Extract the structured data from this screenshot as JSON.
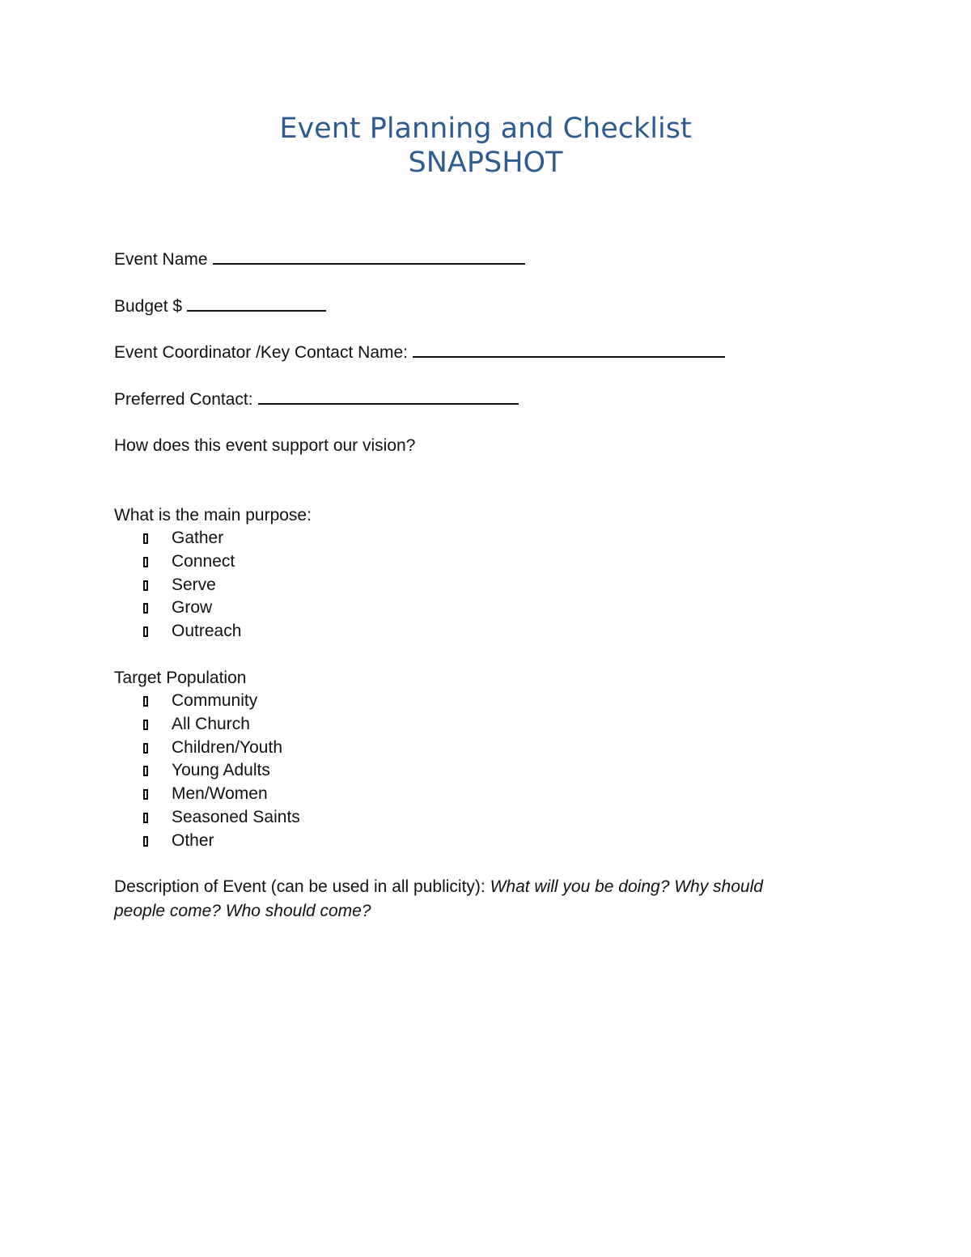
{
  "document": {
    "title_line1": "Event Planning and Checklist",
    "title_line2": "SNAPSHOT",
    "title_color": "#2f5b93"
  },
  "fields": {
    "event_name_label": "Event Name",
    "event_name_value": "",
    "budget_label": "Budget $",
    "budget_value": "",
    "coordinator_label": "Event Coordinator /Key Contact Name:",
    "coordinator_value": "",
    "preferred_contact_label": "Preferred Contact:",
    "preferred_contact_value": ""
  },
  "vision_question": "How does this event support our vision?",
  "purpose": {
    "heading": "What is the main purpose:",
    "options": [
      {
        "label": "Gather",
        "checked": false
      },
      {
        "label": "Connect",
        "checked": false
      },
      {
        "label": "Serve",
        "checked": false
      },
      {
        "label": "Grow",
        "checked": false
      },
      {
        "label": "Outreach",
        "checked": false
      }
    ]
  },
  "target_population": {
    "heading": "Target Population",
    "options": [
      {
        "label": "Community",
        "checked": false
      },
      {
        "label": "All Church",
        "checked": false
      },
      {
        "label": "Children/Youth",
        "checked": false
      },
      {
        "label": "Young Adults",
        "checked": false
      },
      {
        "label": "Men/Women",
        "checked": false
      },
      {
        "label": "Seasoned Saints",
        "checked": false
      },
      {
        "label": "Other",
        "checked": false
      }
    ]
  },
  "description": {
    "label": "Description of Event (can be used in all publicity):",
    "prompt": "What will you be doing? Why should people come? Who should come?"
  }
}
